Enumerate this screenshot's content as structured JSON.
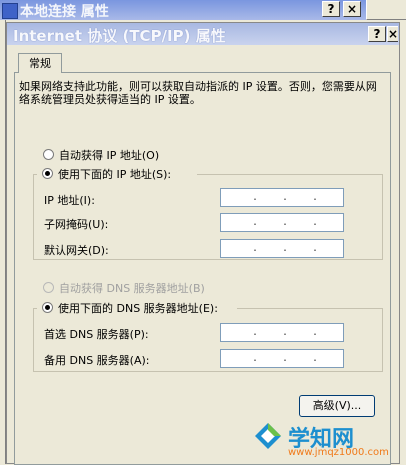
{
  "background_window": {
    "title": "本地连接 属性",
    "help_button": "?",
    "close_button": "×"
  },
  "dialog": {
    "title": "Internet 协议 (TCP/IP) 属性",
    "help_button": "?",
    "close_button": "×"
  },
  "tabs": [
    {
      "label": "常规"
    }
  ],
  "description": "如果网络支持此功能，则可以获取自动指派的 IP 设置。否则，您需要从网络系统管理员处获得适当的 IP 设置。",
  "ip_section": {
    "auto_option": "自动获得 IP 地址(O)",
    "manual_option": "使用下面的 IP 地址(S):",
    "selected": "manual",
    "fields": [
      {
        "label": "IP 地址(I):",
        "value": ". . ."
      },
      {
        "label": "子网掩码(U):",
        "value": ". . ."
      },
      {
        "label": "默认网关(D):",
        "value": ". . ."
      }
    ]
  },
  "dns_section": {
    "auto_option": "自动获得 DNS 服务器地址(B)",
    "auto_enabled": false,
    "manual_option": "使用下面的 DNS 服务器地址(E):",
    "selected": "manual",
    "fields": [
      {
        "label": "首选 DNS 服务器(P):",
        "value": ". . ."
      },
      {
        "label": "备用 DNS 服务器(A):",
        "value": ". . ."
      }
    ]
  },
  "advanced_button": "高级(V)...",
  "watermark": {
    "name": "学知网",
    "url": "www.jmqz1000.com"
  },
  "colors": {
    "dialog_bg": "#ece9d8",
    "title_bar": "#a8b8e2",
    "field_border": "#7f9db9",
    "watermark_blue": "#1d8fcf",
    "watermark_orange": "#f07a1a"
  }
}
